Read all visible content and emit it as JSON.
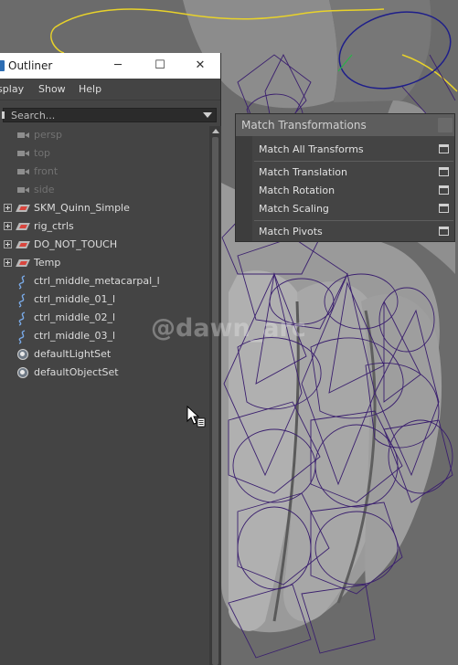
{
  "outliner": {
    "title": "Outliner",
    "window_buttons": {
      "minimize": "─",
      "maximize": "☐",
      "close": "✕"
    },
    "menus": [
      "isplay",
      "Show",
      "Help"
    ],
    "search_placeholder": "Search...",
    "items": [
      {
        "label": "persp",
        "icon": "camera-icon",
        "dim": true,
        "expandable": false
      },
      {
        "label": "top",
        "icon": "camera-icon",
        "dim": true,
        "expandable": false
      },
      {
        "label": "front",
        "icon": "camera-icon",
        "dim": true,
        "expandable": false
      },
      {
        "label": "side",
        "icon": "camera-icon",
        "dim": true,
        "expandable": false
      },
      {
        "label": "SKM_Quinn_Simple",
        "icon": "group-icon",
        "dim": false,
        "expandable": true
      },
      {
        "label": "rig_ctrls",
        "icon": "group-icon",
        "dim": false,
        "expandable": true
      },
      {
        "label": "DO_NOT_TOUCH",
        "icon": "group-icon",
        "dim": false,
        "expandable": true
      },
      {
        "label": "Temp",
        "icon": "group-icon",
        "dim": false,
        "expandable": true
      },
      {
        "label": "ctrl_middle_metacarpal_l",
        "icon": "nurbs-curve-icon",
        "dim": false,
        "expandable": false
      },
      {
        "label": "ctrl_middle_01_l",
        "icon": "nurbs-curve-icon",
        "dim": false,
        "expandable": false
      },
      {
        "label": "ctrl_middle_02_l",
        "icon": "nurbs-curve-icon",
        "dim": false,
        "expandable": false
      },
      {
        "label": "ctrl_middle_03_l",
        "icon": "nurbs-curve-icon",
        "dim": false,
        "expandable": false
      },
      {
        "label": "defaultLightSet",
        "icon": "object-set-icon",
        "dim": false,
        "expandable": false
      },
      {
        "label": "defaultObjectSet",
        "icon": "object-set-icon",
        "dim": false,
        "expandable": false
      }
    ]
  },
  "match_panel": {
    "title": "Match Transformations",
    "items": [
      "Match All Transforms",
      "Match Translation",
      "Match Rotation",
      "Match Scaling",
      "Match Pivots"
    ]
  },
  "watermark": "@dawn_arc",
  "colors": {
    "panel_bg": "#444444",
    "viewport_bg": "#6e6e6e",
    "wireframe": "#3a1f6e",
    "yellow_curve": "#e8d22a",
    "selected_ctrl": "#1e1e8a"
  }
}
